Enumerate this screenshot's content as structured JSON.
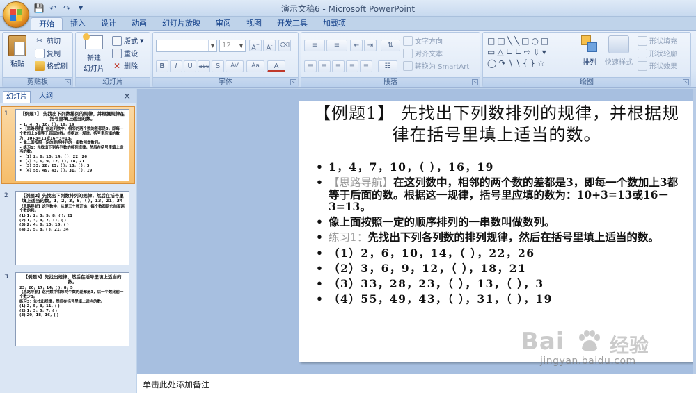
{
  "window": {
    "title": "演示文稿6 - Microsoft PowerPoint"
  },
  "quick_access": [
    "save-icon",
    "undo-icon",
    "redo-icon",
    "customize-icon"
  ],
  "ribbon": {
    "tabs": [
      "开始",
      "插入",
      "设计",
      "动画",
      "幻灯片放映",
      "审阅",
      "视图",
      "开发工具",
      "加载项"
    ],
    "active_tab": "开始",
    "clipboard": {
      "label": "剪贴板",
      "paste": "粘贴",
      "cut": "剪切",
      "copy": "复制",
      "format_painter": "格式刷"
    },
    "slides": {
      "label": "幻灯片",
      "new_slide_line1": "新建",
      "new_slide_line2": "幻灯片",
      "layout": "版式",
      "reset": "重设",
      "delete": "删除"
    },
    "font": {
      "label": "字体",
      "size_placeholder": "12"
    },
    "paragraph": {
      "label": "段落",
      "text_direction": "文字方向",
      "align_text": "对齐文本",
      "convert_smartart": "转换为 SmartArt"
    },
    "drawing": {
      "label": "绘图",
      "arrange": "排列",
      "quick_styles": "快速样式",
      "shape_fill": "形状填充",
      "shape_outline": "形状轮廓",
      "shape_effects": "形状效果"
    }
  },
  "left_pane": {
    "tabs": [
      "幻灯片",
      "大纲"
    ],
    "active_tab": "幻灯片",
    "slides": [
      {
        "number": "1",
        "title": "【例题1】  先找出下列数排列的规律，并根据规律在括号里填上适当的数。",
        "lines": [
          "• 1，4，7，10，（ ），16，19",
          "• 【思路导航】在这列数中，相邻的两个数的差都是3，即每一个数加上3都等于后面的数。根据这一规律，括号里应填的数为：10+3=13或16－3=13。",
          "• 像上面按照一定的顺序排列的一串数叫做数列。",
          "• 练习1：先找出下列各列数的排列规律，然后在括号里填上适当的数。",
          "• （1）2，6，10，14，（ ），22，26",
          "• （2）3，6，9，12，（ ），18，21",
          "• （3）33，28，23，（ ），13，（ ），3",
          "• （4）55，49，43，（ ），31，（ ），19"
        ]
      },
      {
        "number": "2",
        "title": "【例题2】先找出下列数排列的规律，然后在括号里填上适当的数。1，2，3，5，（ ），13，21，34",
        "lines": [
          "【思路导航】这列数中，从第三个数开始，每个数都是它前面两个数的和。",
          "(1) 1，2，3，5，8，( )，21",
          "(2) 1，3，4，7，11，( )",
          "(3) 2，4，6，10，16，( )",
          "(4) 3，5，8，( )，21，34"
        ]
      },
      {
        "number": "3",
        "title": "【例题3】先找出规律，然后在括号里填上适当的数。",
        "lines": [
          "23，20，17，14，( )，8，5",
          "【思路导航】这列数中相邻两个数的差都是3，后一个数比前一个数少3。",
          "练习3：先找出规律，然后在括号里填上适当的数。",
          "(1) 2，5，8，11，( )",
          "(2) 1，3，5，7，( )",
          "(3) 20，18，16，( )"
        ]
      }
    ]
  },
  "slide": {
    "title_bracket": "【例题1】",
    "title_text": "  先找出下列数排列的规律，并根据规律在括号里填上适当的数。",
    "b1": "1，4，7，10，（     ），16，19",
    "b2_label": "【思路导航】",
    "b2_text": "在这列数中，相邻的两个数的差都是3，即每一个数加上3都等于后面的数。根据这一规律，括号里应填的数为：10+3=13或16－3=13。",
    "b3": "像上面按照一定的顺序排列的一串数叫做数列。",
    "b4_label": "练习1：",
    "b4_text": "先找出下列各列数的排列规律，然后在括号里填上适当的数。",
    "b5": "（1）2，6，10，14，（     ），22，26",
    "b6": "（2）3，6，9，12，（     ），18，21",
    "b7": "（3）33，28，23，（     ），13，（     ），3",
    "b8": "（4）55，49，43，（     ），31，（     ），19"
  },
  "notes": {
    "placeholder": "单击此处添加备注"
  },
  "watermark": {
    "brand": "Bai",
    "brand2": "经验",
    "url": "jingyan.baidu.com"
  }
}
